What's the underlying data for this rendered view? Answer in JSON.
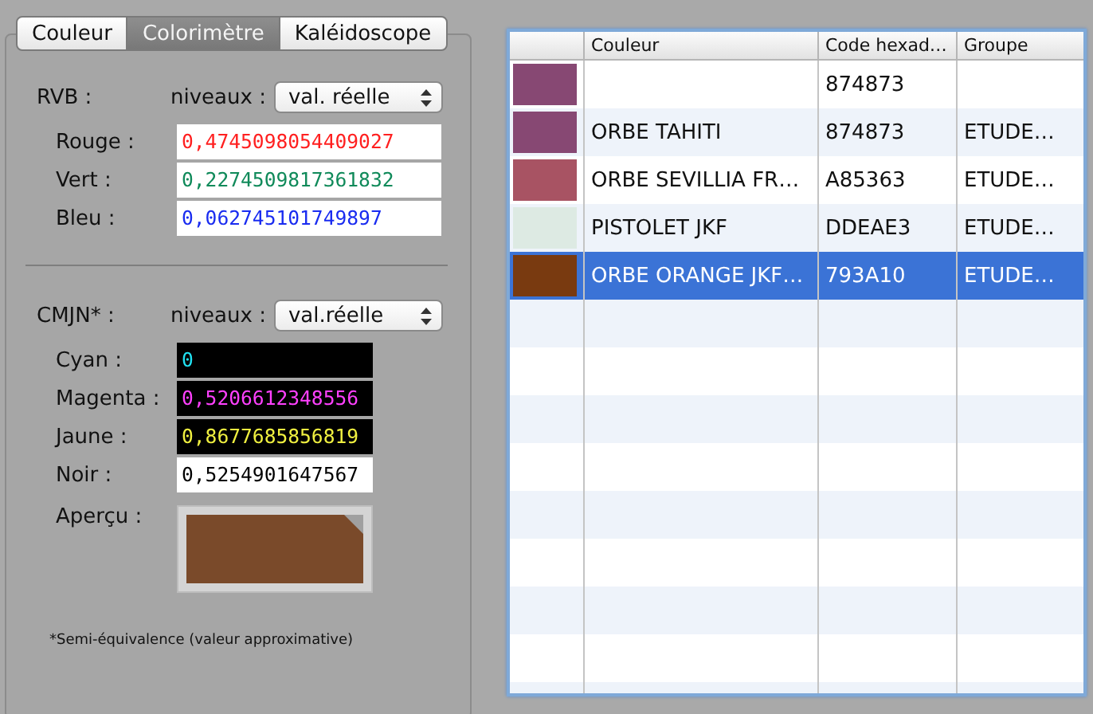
{
  "tabs": [
    {
      "label": "Couleur",
      "selected": false
    },
    {
      "label": "Colorimètre",
      "selected": true
    },
    {
      "label": "Kaléidoscope",
      "selected": false
    }
  ],
  "rgb": {
    "label": "RVB :",
    "levels_label": "niveaux :",
    "popup": "val. réelle",
    "fields": [
      {
        "label": "Rouge :",
        "value": "0,4745098054409027",
        "color": "#ff2020",
        "dark": false
      },
      {
        "label": "Vert :",
        "value": "0,2274509817361832",
        "color": "#108a5a",
        "dark": false
      },
      {
        "label": "Bleu :",
        "value": "0,062745101749897",
        "color": "#1a2cf0",
        "dark": false
      }
    ]
  },
  "cmyk": {
    "label": "CMJN* :",
    "levels_label": "niveaux :",
    "popup": "val.réelle",
    "fields": [
      {
        "label": "Cyan :",
        "value": "0",
        "color": "#20e0f0",
        "dark": true
      },
      {
        "label": "Magenta :",
        "value": "0,5206612348556",
        "color": "#ff40ff",
        "dark": true
      },
      {
        "label": "Jaune :",
        "value": "0,8677685856819",
        "color": "#f0f040",
        "dark": true
      },
      {
        "label": "Noir :",
        "value": "0,5254901647567",
        "color": "#000000",
        "dark": false
      }
    ]
  },
  "preview": {
    "label": "Aperçu :",
    "color": "#7a4a2a"
  },
  "footnote": "*Semi-équivalence (valeur approximative)",
  "table": {
    "columns": [
      "Couleur",
      "Code hexad…",
      "Groupe"
    ],
    "rows": [
      {
        "color": "#874873",
        "name": "",
        "code": "874873",
        "group": "",
        "selected": false
      },
      {
        "color": "#874873",
        "name": "ORBE TAHITI",
        "code": "874873",
        "group": "ETUDE…",
        "selected": false
      },
      {
        "color": "#a85363",
        "name": "ORBE SEVILLIA FR…",
        "code": "A85363",
        "group": "ETUDE…",
        "selected": false
      },
      {
        "color": "#ddeae3",
        "name": "PISTOLET JKF",
        "code": "DDEAE3",
        "group": "ETUDE…",
        "selected": false
      },
      {
        "color": "#793a10",
        "name": "ORBE ORANGE JKF…",
        "code": "793A10",
        "group": "ETUDE…",
        "selected": true
      }
    ]
  }
}
